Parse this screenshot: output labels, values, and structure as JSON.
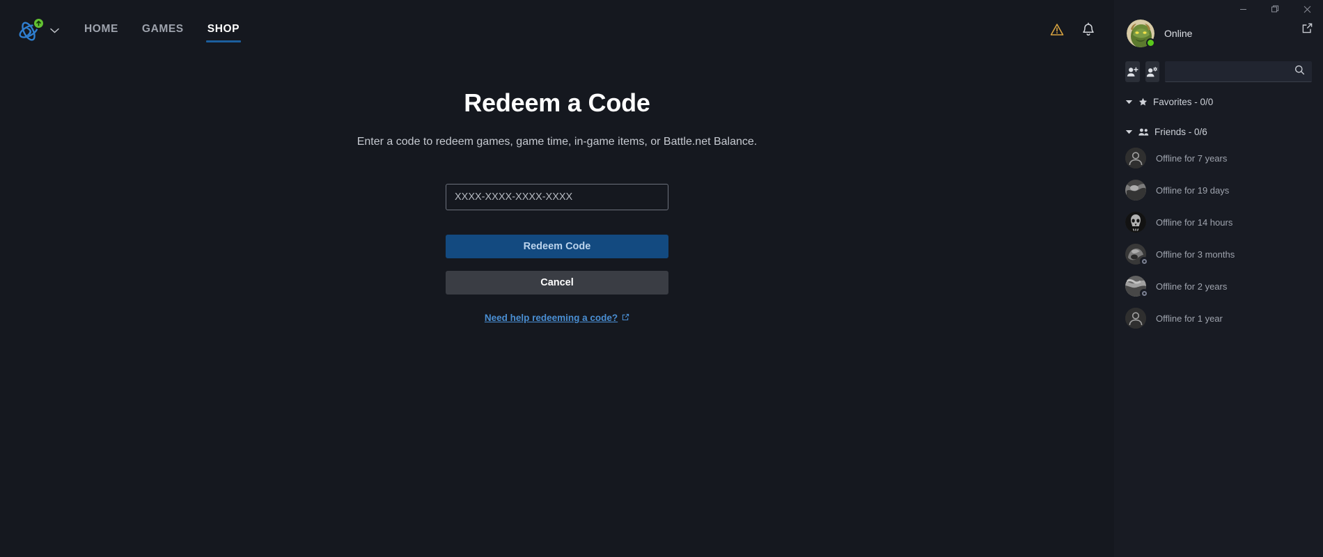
{
  "window": {
    "minimize_label": "Minimize",
    "maximize_label": "Restore",
    "close_label": "Close"
  },
  "nav": {
    "logo_name": "battlenet-logo",
    "update_badge": "update-available",
    "links": [
      {
        "label": "HOME",
        "active": false
      },
      {
        "label": "GAMES",
        "active": false
      },
      {
        "label": "SHOP",
        "active": true
      }
    ],
    "icons": [
      {
        "name": "warning-icon",
        "color": "#d9a441"
      },
      {
        "name": "bell-icon",
        "color": "#d6d9de"
      }
    ]
  },
  "main": {
    "title": "Redeem a Code",
    "subtitle": "Enter a code to redeem games, game time, in-game items, or Battle.net Balance.",
    "code_placeholder": "XXXX-XXXX-XXXX-XXXX",
    "code_value": "",
    "redeem_label": "Redeem Code",
    "cancel_label": "Cancel",
    "help_label": "Need help redeeming a code?"
  },
  "sidebar": {
    "status": "Online",
    "popout_icon": "external-link-icon",
    "add_friend_icon": "add-friend-icon",
    "manage_friends_icon": "manage-friends-icon",
    "search_placeholder": "",
    "search_value": "",
    "groups": [
      {
        "label": "Favorites - 0/0",
        "icon": "star-icon"
      },
      {
        "label": "Friends - 0/6",
        "icon": "people-icon"
      }
    ],
    "friends": [
      {
        "status": "Offline for 7 years",
        "avatar": "default",
        "avatar_color": "#34383f"
      },
      {
        "status": "Offline for 19 days",
        "avatar": "artwork",
        "avatar_color": "#6d7178"
      },
      {
        "status": "Offline for 14 hours",
        "avatar": "skull",
        "avatar_color": "#1c1d20"
      },
      {
        "status": "Offline for 3 months",
        "avatar": "artwork2",
        "avatar_color": "#585c63"
      },
      {
        "status": "Offline for 2 years",
        "avatar": "artwork3",
        "avatar_color": "#8a8e95"
      },
      {
        "status": "Offline for 1 year",
        "avatar": "default",
        "avatar_color": "#34383f"
      }
    ]
  },
  "colors": {
    "app_bg": "#15181f",
    "sidebar_bg": "#181b23",
    "accent_blue": "#134a80",
    "link_blue": "#4a8fd4",
    "online_green": "#5ac81c",
    "warning_amber": "#d9a441"
  }
}
